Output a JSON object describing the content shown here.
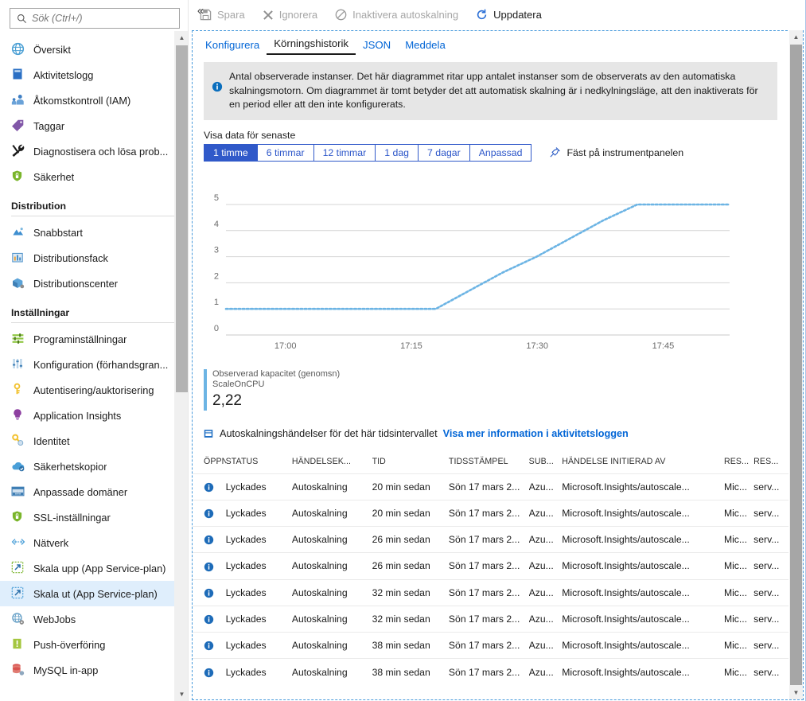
{
  "sidebar": {
    "search": {
      "placeholder": "Sök (Ctrl+/)",
      "value": ""
    },
    "collapse_label": "«",
    "items": [
      {
        "label": "Översikt",
        "icon": "overview-globe-icon",
        "group": null,
        "active": false
      },
      {
        "label": "Aktivitetslogg",
        "icon": "activity-log-icon",
        "group": null,
        "active": false
      },
      {
        "label": "Åtkomstkontroll (IAM)",
        "icon": "access-control-icon",
        "group": null,
        "active": false
      },
      {
        "label": "Taggar",
        "icon": "tag-icon",
        "group": null,
        "active": false
      },
      {
        "label": "Diagnostisera och lösa prob...",
        "icon": "diagnose-tools-icon",
        "group": null,
        "active": false
      },
      {
        "label": "Säkerhet",
        "icon": "security-shield-icon",
        "group": null,
        "active": false
      }
    ],
    "groups": [
      {
        "title": "Distribution",
        "items": [
          {
            "label": "Snabbstart",
            "icon": "quickstart-cloud-icon",
            "active": false
          },
          {
            "label": "Distributionsfack",
            "icon": "deployment-slots-icon",
            "active": false
          },
          {
            "label": "Distributionscenter",
            "icon": "deployment-center-icon",
            "active": false
          }
        ]
      },
      {
        "title": "Inställningar",
        "items": [
          {
            "label": "Programinställningar",
            "icon": "app-settings-sliders-icon",
            "active": false
          },
          {
            "label": "Konfiguration (förhandsgran...",
            "icon": "configuration-sliders-icon",
            "active": false
          },
          {
            "label": "Autentisering/auktorisering",
            "icon": "auth-key-icon",
            "active": false
          },
          {
            "label": "Application Insights",
            "icon": "app-insights-bulb-icon",
            "active": false
          },
          {
            "label": "Identitet",
            "icon": "identity-key-icon",
            "active": false
          },
          {
            "label": "Säkerhetskopior",
            "icon": "backup-cloud-icon",
            "active": false
          },
          {
            "label": "Anpassade domäner",
            "icon": "custom-domains-www-icon",
            "active": false
          },
          {
            "label": "SSL-inställningar",
            "icon": "ssl-shield-lock-icon",
            "active": false
          },
          {
            "label": "Nätverk",
            "icon": "networking-icon",
            "active": false
          },
          {
            "label": "Skala upp (App Service-plan)",
            "icon": "scale-up-icon",
            "active": false
          },
          {
            "label": "Skala ut (App Service-plan)",
            "icon": "scale-out-icon",
            "active": true
          },
          {
            "label": "WebJobs",
            "icon": "webjobs-icon",
            "active": false
          },
          {
            "label": "Push-överföring",
            "icon": "push-notification-icon",
            "active": false
          },
          {
            "label": "MySQL in-app",
            "icon": "mysql-inapp-icon",
            "active": false
          }
        ]
      }
    ]
  },
  "toolbar": {
    "save_label": "Spara",
    "discard_label": "Ignorera",
    "disable_label": "Inaktivera autoskalning",
    "refresh_label": "Uppdatera"
  },
  "tabs": [
    {
      "label": "Konfigurera",
      "active": false
    },
    {
      "label": "Körningshistorik",
      "active": true
    },
    {
      "label": "JSON",
      "active": false
    },
    {
      "label": "Meddela",
      "active": false
    }
  ],
  "info_banner": {
    "text": "Antal observerade instanser. Det här diagrammet ritar upp antalet instanser som de observerats av den automatiska skalningsmotorn. Om diagrammet är tomt betyder det att automatisk skalning är i nedkylningsläge, att den inaktiverats för en period eller att den inte konfigurerats."
  },
  "time_range": {
    "label": "Visa data för senaste",
    "options": [
      "1 timme",
      "6 timmar",
      "12 timmar",
      "1 dag",
      "7 dagar",
      "Anpassad"
    ],
    "selected": "1 timme",
    "pin_label": "Fäst på instrumentpanelen"
  },
  "chart_data": {
    "type": "line",
    "title": "",
    "xlabel": "",
    "ylabel": "",
    "ylim": [
      0,
      5
    ],
    "yticks": [
      0,
      1,
      2,
      3,
      4,
      5
    ],
    "xticks": [
      "17:00",
      "17:15",
      "17:30",
      "17:45"
    ],
    "xlim": [
      "16:53",
      "17:53"
    ],
    "grid": true,
    "line_color": "#6cb4e4",
    "line_style": "dotted",
    "series": [
      {
        "name": "Observerad kapacitet (genomsn) ScaleOnCPU",
        "x": [
          "16:53",
          "17:00",
          "17:10",
          "17:15",
          "17:18",
          "17:22",
          "17:26",
          "17:30",
          "17:34",
          "17:38",
          "17:42",
          "17:45",
          "17:50",
          "17:53"
        ],
        "values": [
          1,
          1,
          1,
          1,
          1,
          1.7,
          2.4,
          3,
          3.7,
          4.4,
          5,
          5,
          5,
          5
        ]
      }
    ],
    "legend": {
      "position": "bottom-left",
      "metric_label": "Observerad kapacitet (genomsn)",
      "resource_label": "ScaleOnCPU",
      "value": "2,22",
      "color": "#6cb4e4"
    }
  },
  "events": {
    "heading": "Autoskalningshändelser för det här tidsintervallet",
    "link": "Visa mer information i aktivitetsloggen",
    "columns": [
      "ÖPPNA",
      "STATUS",
      "HÄNDELSEK...",
      "TID",
      "TIDSSTÄMPEL",
      "SUB...",
      "HÄNDELSE INITIERAD AV",
      "RES...",
      "RES..."
    ],
    "rows": [
      {
        "open": "info-icon",
        "status": "Lyckades",
        "kind": "Autoskalning",
        "time": "20 min sedan",
        "stamp": "Sön 17 mars 2...",
        "sub": "Azu...",
        "initiated": "Microsoft.Insights/autoscale...",
        "res1": "Mic...",
        "res2": "serv..."
      },
      {
        "open": "info-icon",
        "status": "Lyckades",
        "kind": "Autoskalning",
        "time": "20 min sedan",
        "stamp": "Sön 17 mars 2...",
        "sub": "Azu...",
        "initiated": "Microsoft.Insights/autoscale...",
        "res1": "Mic...",
        "res2": "serv..."
      },
      {
        "open": "info-icon",
        "status": "Lyckades",
        "kind": "Autoskalning",
        "time": "26 min sedan",
        "stamp": "Sön 17 mars 2...",
        "sub": "Azu...",
        "initiated": "Microsoft.Insights/autoscale...",
        "res1": "Mic...",
        "res2": "serv..."
      },
      {
        "open": "info-icon",
        "status": "Lyckades",
        "kind": "Autoskalning",
        "time": "26 min sedan",
        "stamp": "Sön 17 mars 2...",
        "sub": "Azu...",
        "initiated": "Microsoft.Insights/autoscale...",
        "res1": "Mic...",
        "res2": "serv..."
      },
      {
        "open": "info-icon",
        "status": "Lyckades",
        "kind": "Autoskalning",
        "time": "32 min sedan",
        "stamp": "Sön 17 mars 2...",
        "sub": "Azu...",
        "initiated": "Microsoft.Insights/autoscale...",
        "res1": "Mic...",
        "res2": "serv..."
      },
      {
        "open": "info-icon",
        "status": "Lyckades",
        "kind": "Autoskalning",
        "time": "32 min sedan",
        "stamp": "Sön 17 mars 2...",
        "sub": "Azu...",
        "initiated": "Microsoft.Insights/autoscale...",
        "res1": "Mic...",
        "res2": "serv..."
      },
      {
        "open": "info-icon",
        "status": "Lyckades",
        "kind": "Autoskalning",
        "time": "38 min sedan",
        "stamp": "Sön 17 mars 2...",
        "sub": "Azu...",
        "initiated": "Microsoft.Insights/autoscale...",
        "res1": "Mic...",
        "res2": "serv..."
      },
      {
        "open": "info-icon",
        "status": "Lyckades",
        "kind": "Autoskalning",
        "time": "38 min sedan",
        "stamp": "Sön 17 mars 2...",
        "sub": "Azu...",
        "initiated": "Microsoft.Insights/autoscale...",
        "res1": "Mic...",
        "res2": "serv..."
      }
    ]
  },
  "colors": {
    "accent_blue": "#0366d6",
    "button_blue": "#3059c9",
    "chart_line": "#6cb4e4",
    "active_nav": "#dfeefc",
    "info_bg": "#e6e6e6"
  }
}
